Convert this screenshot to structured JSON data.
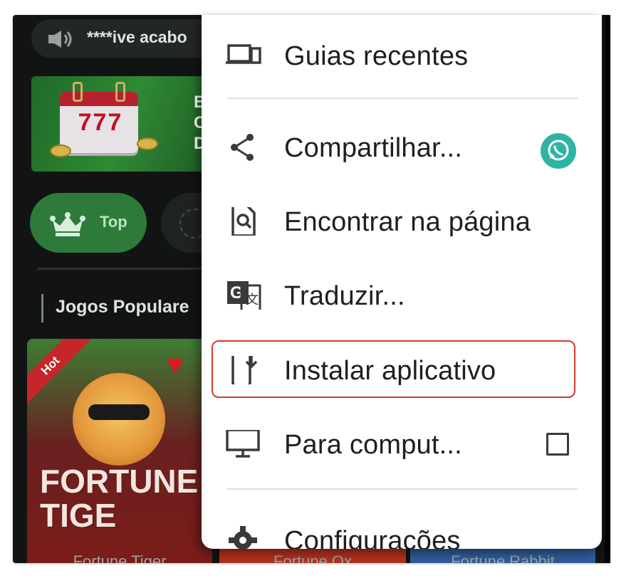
{
  "background": {
    "marquee_text": "****ive acabo",
    "banner_lines": [
      "Bô",
      "Ch",
      "Diá"
    ],
    "banner_calendar_number": "777",
    "pill_top_label": "Top",
    "section_title": "Jogos Populare",
    "cards": [
      {
        "badge": "Hot",
        "title_line1": "FORTUNE",
        "title_line2": "TIGE",
        "caption": "Fortune Tiger"
      },
      {
        "caption": "Fortune Ox"
      },
      {
        "caption": "Fortune Rabbit"
      }
    ]
  },
  "menu": {
    "items": [
      {
        "label": "Guias recentes",
        "icon": "devices-icon"
      },
      {
        "label": "Compartilhar...",
        "icon": "share-icon",
        "trailing": "whatsapp-icon"
      },
      {
        "label": "Encontrar na página",
        "icon": "find-in-page-icon"
      },
      {
        "label": "Traduzir...",
        "icon": "translate-icon"
      },
      {
        "label": "Instalar aplicativo",
        "icon": "install-app-icon",
        "highlighted": true
      },
      {
        "label": "Para comput...",
        "icon": "desktop-icon",
        "trailing": "checkbox",
        "checked": false
      },
      {
        "label": "Configurações",
        "icon": "gear-icon"
      }
    ]
  },
  "colors": {
    "menu_background": "#ffffff",
    "highlight_border": "#d23a2e",
    "whatsapp_badge": "#2fb4a3",
    "page_background": "#121414",
    "top_pill": "#2e7a3a"
  }
}
